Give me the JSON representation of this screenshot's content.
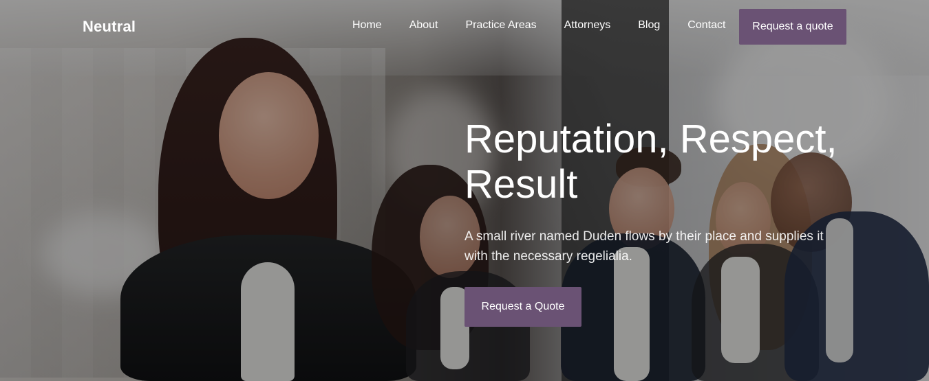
{
  "brand": {
    "name": "Neutral"
  },
  "nav": {
    "items": [
      {
        "label": "Home"
      },
      {
        "label": "About"
      },
      {
        "label": "Practice Areas"
      },
      {
        "label": "Attorneys"
      },
      {
        "label": "Blog"
      },
      {
        "label": "Contact"
      }
    ],
    "cta_label": "Request a quote"
  },
  "hero": {
    "title": "Reputation, Respect, Result",
    "subtitle": "A small river named Duden flows by their place and supplies it with the necessary regelialia.",
    "cta_label": "Request a Quote"
  },
  "colors": {
    "accent": "#6a5274",
    "text": "#ffffff"
  }
}
